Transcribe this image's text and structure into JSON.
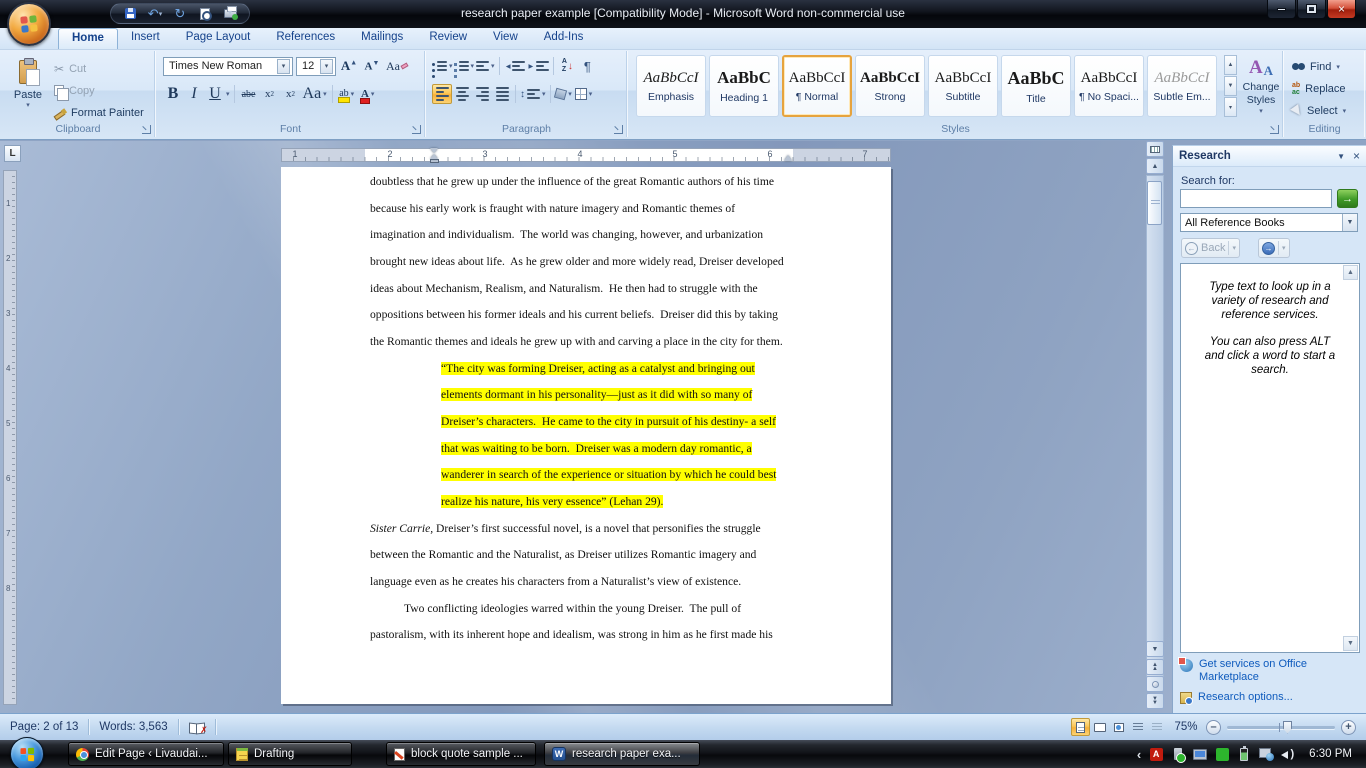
{
  "window": {
    "title": "research paper example [Compatibility Mode]  -  Microsoft Word non-commercial use"
  },
  "colors": {
    "highlight": "#ffff00",
    "style_selected_border": "#e6a33e",
    "active_button_orange": "#fcc757",
    "link": "#0f5bbd"
  },
  "ribbon": {
    "tabs": [
      "Home",
      "Insert",
      "Page Layout",
      "References",
      "Mailings",
      "Review",
      "View",
      "Add-Ins"
    ],
    "active_tab": "Home",
    "clipboard": {
      "title": "Clipboard",
      "paste": "Paste",
      "cut": "Cut",
      "copy": "Copy",
      "format_painter": "Format Painter"
    },
    "font": {
      "title": "Font",
      "family": "Times New Roman",
      "size": "12"
    },
    "paragraph": {
      "title": "Paragraph"
    },
    "styles": {
      "title": "Styles",
      "change_styles": "Change Styles",
      "items": [
        {
          "preview": "AaBbCcI",
          "label": "Emphasis"
        },
        {
          "preview": "AaBbC",
          "label": "Heading 1"
        },
        {
          "preview": "AaBbCcI",
          "label": "¶ Normal"
        },
        {
          "preview": "AaBbCcI",
          "label": "Strong"
        },
        {
          "preview": "AaBbCcI",
          "label": "Subtitle"
        },
        {
          "preview": "AaBbC",
          "label": "Title"
        },
        {
          "preview": "AaBbCcI",
          "label": "¶ No Spaci..."
        },
        {
          "preview": "AaBbCcI",
          "label": "Subtle Em..."
        }
      ]
    },
    "editing": {
      "title": "Editing",
      "find": "Find",
      "replace": "Replace",
      "select": "Select"
    }
  },
  "ruler": {
    "h_numbers": [
      "1",
      "2",
      "3",
      "4",
      "5",
      "6",
      "7"
    ],
    "v_numbers": [
      "1",
      "2",
      "3",
      "4",
      "5",
      "6",
      "7",
      "8"
    ]
  },
  "document": {
    "body1": [
      "doubtless that he grew up under the influence of the great Romantic authors of his time",
      "because his early work is fraught with nature imagery and Romantic themes of",
      "imagination and individualism.  The world was changing, however, and urbanization",
      "brought new ideas about life.  As he grew older and more widely read, Dreiser developed",
      "ideas about Mechanism, Realism, and Naturalism.  He then had to struggle with the",
      "oppositions between his former ideals and his current beliefs.  Dreiser did this by taking",
      "the Romantic themes and ideals he grew up with and carving a place in the city for them."
    ],
    "quote": [
      "“The city was forming Dreiser, acting as a catalyst and bringing out",
      "elements dormant in his personality—just as it did with so many of",
      "Dreiser’s characters.  He came to the city in pursuit of his destiny- a self",
      "that was waiting to be born.  Dreiser was a modern day romantic, a",
      "wanderer in search of the experience or situation by which he could best",
      "realize his nature, his very essence” (Lehan 29)."
    ],
    "p2_italic": "Sister Carrie,",
    "p2_rest": " Dreiser’s first successful novel, is a novel that personifies the struggle",
    "body2": [
      "between the Romantic and the Naturalist, as Dreiser utilizes Romantic imagery and",
      "language even as he creates his characters from a Naturalist’s view of existence."
    ],
    "body3": [
      "Two conflicting ideologies warred within the young Dreiser.  The pull of",
      "pastoralism, with its inherent hope and idealism, was strong in him as he first made his"
    ]
  },
  "research": {
    "title": "Research",
    "search_label": "Search for:",
    "search_value": "",
    "source": "All Reference Books",
    "back": "Back",
    "instructions_1": "Type text to look up in a variety of research and reference services.",
    "instructions_2": "You can also press ALT and click a word to start a search.",
    "link_marketplace": "Get services on Office Marketplace",
    "link_options": "Research options..."
  },
  "status": {
    "page": "Page: 2 of 13",
    "words": "Words: 3,563",
    "zoom": "75%"
  },
  "taskbar": {
    "tasks": [
      "Edit Page ‹ Livaudai...",
      "Drafting",
      "block quote sample ...",
      "research paper exa..."
    ],
    "time": "6:30 PM"
  },
  "glyphs": {
    "dropdown": "▾",
    "up": "▲",
    "down": "▼",
    "up_down": "↕",
    "down_arrow": "↓",
    "undo": "↶",
    "repeat": "↻",
    "close": "×",
    "cut": "✂",
    "bold": "B",
    "italic": "I",
    "underline": "U",
    "strike": "abe",
    "sub_x": "x",
    "sub_n": "2",
    "sup_x": "x",
    "sup_n": "2",
    "case": "Aa",
    "grow": "A",
    "shrink": "A",
    "clear": "Aa",
    "highlight": "ab",
    "font_color": "A",
    "sort_a": "A",
    "sort_z": "Z",
    "pilcrow": "¶",
    "tab_selector": "L",
    "replace_top": "ab",
    "replace_bottom": "ac",
    "x_mark": "✗",
    "word_w": "W",
    "acrobat_a": "A",
    "go": "→",
    "back_arrow": "←",
    "forward_arrow": "→",
    "chevron_left": "‹",
    "minus": "–",
    "plus": "+",
    "wave": ")"
  }
}
